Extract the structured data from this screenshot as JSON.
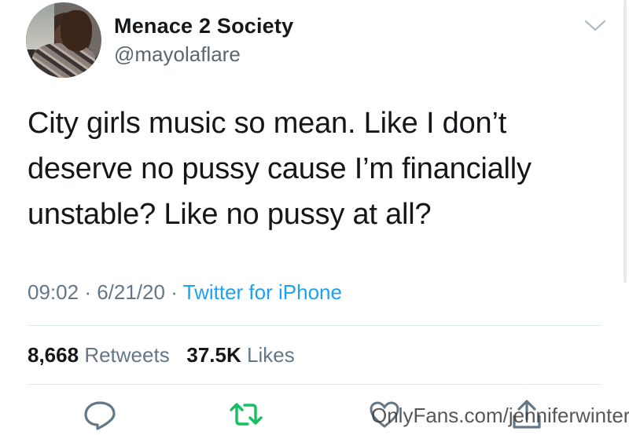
{
  "tweet": {
    "author_name": "Menace 2 Society",
    "handle": "@mayolaflare",
    "text": "City girls music so mean. Like I don’t\ndeserve no pussy cause I’m financially\nunstable? Like no pussy at all?",
    "time": "09:02",
    "date": "6/21/20",
    "separator": "·",
    "source": "Twitter for iPhone",
    "retweets_count": "8,668",
    "retweets_label": "Retweets",
    "likes_count": "37.5K",
    "likes_label": "Likes"
  },
  "actions": {
    "reply_icon": "reply-icon",
    "retweet_icon": "retweet-icon",
    "like_icon": "heart-icon",
    "share_icon": "share-icon"
  },
  "watermark": "OnlyFans.com/jenniferwinters",
  "colors": {
    "text": "#14171a",
    "secondary": "#657786",
    "link": "#1da1f2",
    "retweet_green": "#17bf63",
    "icon_gray": "#657786",
    "divider": "#e1e8ed"
  }
}
